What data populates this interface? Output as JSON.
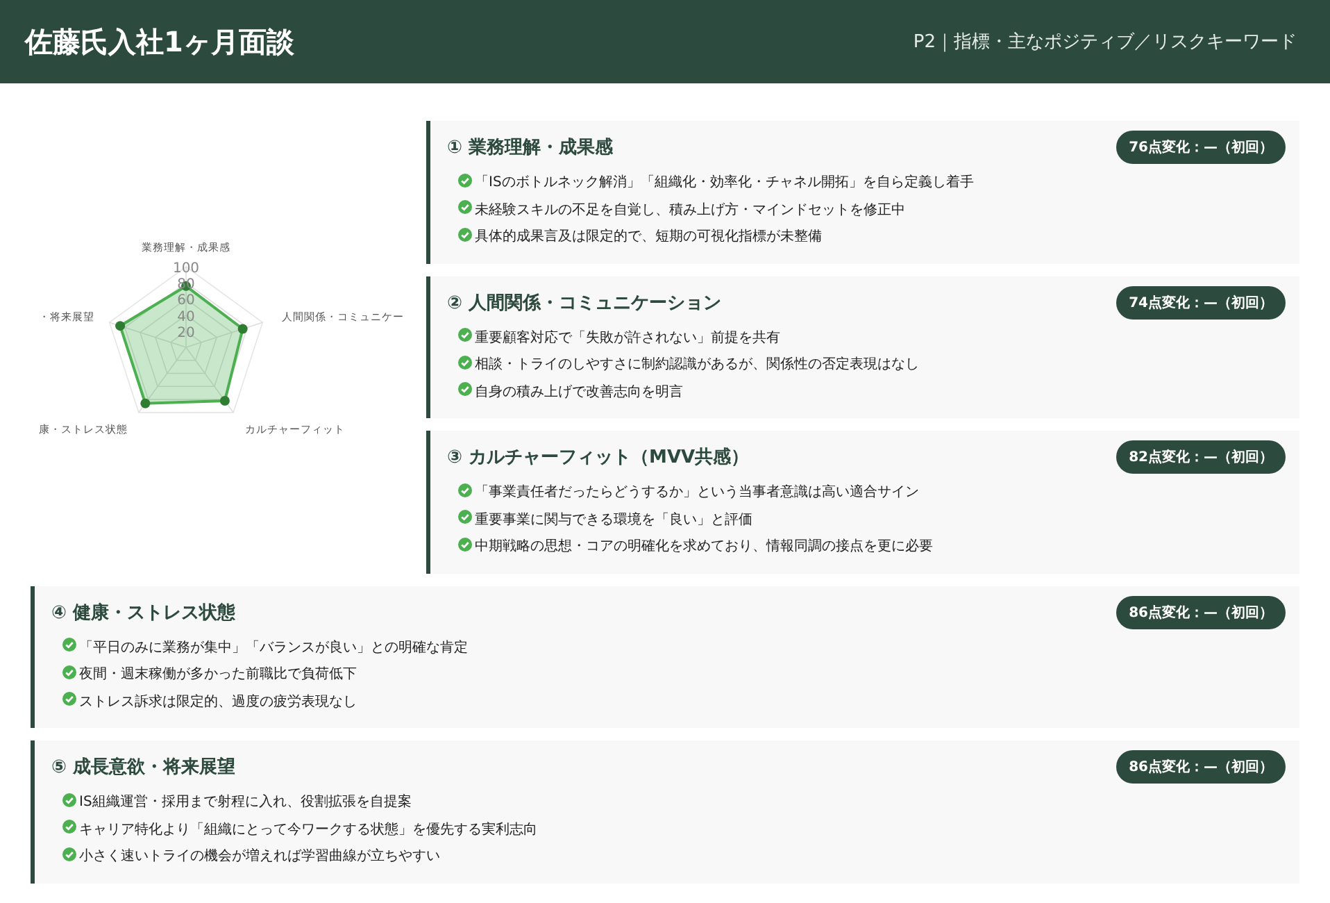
{
  "header": {
    "title": "佐藤氏入社1ヶ月面談",
    "page_label": "P2｜指標・主なポジティブ／リスクキーワード"
  },
  "radar": {
    "chart_data": {
      "type": "radar",
      "categories": [
        "業務理解・成果感",
        "人間関係・コミュニケー",
        "カルチャーフィット",
        "康・ストレス状態",
        "・将来展望"
      ],
      "series": [
        {
          "color": "#4caf50",
          "values": [
            76,
            74,
            82,
            86,
            86
          ]
        }
      ],
      "ylim": [
        0,
        100
      ],
      "yticks": [
        20,
        40,
        60,
        80,
        100
      ]
    }
  },
  "sections": [
    {
      "title": "① 業務理解・成果感",
      "badge": "76点変化：—（初回）",
      "points": [
        "「ISのボトルネック解消」「組織化・効率化・チャネル開拓」を自ら定義し着手",
        "未経験スキルの不足を自覚し、積み上げ方・マインドセットを修正中",
        "具体的成果言及は限定的で、短期の可視化指標が未整備"
      ]
    },
    {
      "title": "② 人間関係・コミュニケーション",
      "badge": "74点変化：—（初回）",
      "points": [
        "重要顧客対応で「失敗が許されない」前提を共有",
        "相談・トライのしやすさに制約認識があるが、関係性の否定表現はなし",
        "自身の積み上げで改善志向を明言"
      ]
    },
    {
      "title": "③ カルチャーフィット（MVV共感）",
      "badge": "82点変化：—（初回）",
      "points": [
        "「事業責任者だったらどうするか」という当事者意識は高い適合サイン",
        "重要事業に関与できる環境を「良い」と評価",
        "中期戦略の思想・コアの明確化を求めており、情報同調の接点を更に必要"
      ]
    },
    {
      "title": "④ 健康・ストレス状態",
      "badge": "86点変化：—（初回）",
      "points": [
        "「平日のみに業務が集中」「バランスが良い」との明確な肯定",
        "夜間・週末稼働が多かった前職比で負荷低下",
        "ストレス訴求は限定的、過度の疲労表現なし"
      ]
    },
    {
      "title": "⑤ 成長意欲・将来展望",
      "badge": "86点変化：—（初回）",
      "points": [
        "IS組織運営・採用まで射程に入れ、役割拡張を自提案",
        "キャリア特化より「組織にとって今ワークする状態」を優先する実利志向",
        "小さく速いトライの機会が増えれば学習曲線が立ちやすい"
      ]
    }
  ]
}
